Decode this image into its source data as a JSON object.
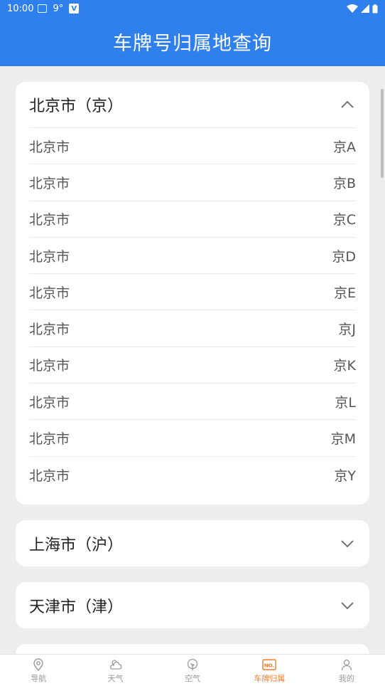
{
  "status_bar": {
    "time": "10:00",
    "temp": "9°",
    "v_label": "V"
  },
  "header": {
    "title": "车牌号归属地查询"
  },
  "sections": [
    {
      "title": "北京市（京）",
      "expanded": true,
      "rows": [
        {
          "city": "北京市",
          "code": "京A"
        },
        {
          "city": "北京市",
          "code": "京B"
        },
        {
          "city": "北京市",
          "code": "京C"
        },
        {
          "city": "北京市",
          "code": "京D"
        },
        {
          "city": "北京市",
          "code": "京E"
        },
        {
          "city": "北京市",
          "code": "京J"
        },
        {
          "city": "北京市",
          "code": "京K"
        },
        {
          "city": "北京市",
          "code": "京L"
        },
        {
          "city": "北京市",
          "code": "京M"
        },
        {
          "city": "北京市",
          "code": "京Y"
        }
      ]
    },
    {
      "title": "上海市（沪）",
      "expanded": false
    },
    {
      "title": "天津市（津）",
      "expanded": false
    }
  ],
  "bottom_nav": [
    {
      "label": "导航",
      "icon": "location-pin-icon",
      "active": false
    },
    {
      "label": "天气",
      "icon": "weather-cloud-icon",
      "active": false
    },
    {
      "label": "空气",
      "icon": "leaf-icon",
      "active": false
    },
    {
      "label": "车牌归属",
      "icon": "license-plate-icon",
      "active": true,
      "icon_text": "NO."
    },
    {
      "label": "我的",
      "icon": "user-icon",
      "active": false
    }
  ],
  "colors": {
    "primary": "#2f80ed",
    "active_tab": "#f07a2c"
  }
}
